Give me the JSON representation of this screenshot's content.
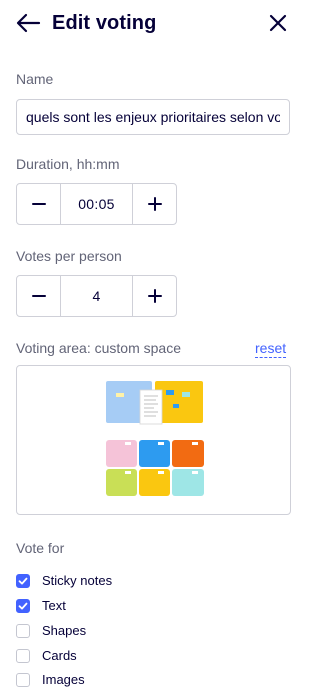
{
  "header": {
    "title": "Edit voting",
    "back_icon": "arrow-left-icon",
    "close_icon": "close-icon"
  },
  "name_field": {
    "label": "Name",
    "value": "quels sont les enjeux prioritaires selon vous"
  },
  "duration": {
    "label": "Duration, hh:mm",
    "value": "00:05",
    "decrement_icon": "minus-icon",
    "increment_icon": "plus-icon"
  },
  "votes": {
    "label": "Votes per person",
    "value": "4",
    "decrement_icon": "minus-icon",
    "increment_icon": "plus-icon"
  },
  "voting_area": {
    "label": "Voting area: custom space",
    "reset_label": "reset"
  },
  "vote_for": {
    "label": "Vote for",
    "options": [
      {
        "label": "Sticky notes",
        "checked": true
      },
      {
        "label": "Text",
        "checked": true
      },
      {
        "label": "Shapes",
        "checked": false
      },
      {
        "label": "Cards",
        "checked": false
      },
      {
        "label": "Images",
        "checked": false
      }
    ]
  },
  "colors": {
    "text": "#050038",
    "muted": "#626477",
    "accent": "#4262ff",
    "border": "#cfd0d8",
    "sticky_pink": "#f5c3d8",
    "sticky_blue": "#2d9bf0",
    "sticky_orange": "#f26b12",
    "sticky_lime": "#c9df56",
    "sticky_yellow": "#fac710",
    "sticky_cyan": "#9ee6e6",
    "frame_lightblue": "#a6ccf5"
  }
}
